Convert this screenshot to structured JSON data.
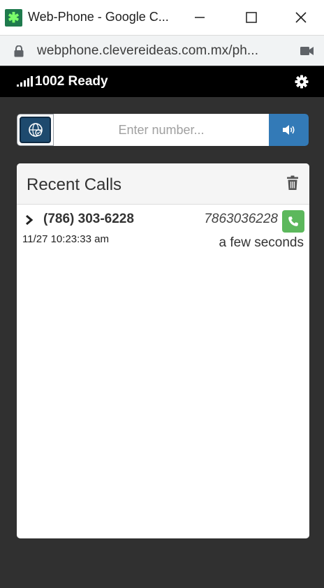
{
  "window": {
    "title": "Web-Phone - Google C...",
    "icon": "app-asterisk-icon"
  },
  "address_bar": {
    "url": "webphone.clevereideas.com.mx/ph..."
  },
  "status": {
    "text": "1002 Ready",
    "icon": "signal-icon"
  },
  "dialer": {
    "placeholder": "Enter number...",
    "value": ""
  },
  "recent_calls": {
    "title": "Recent Calls",
    "items": [
      {
        "name": "(786) 303-6228",
        "number": "7863036228",
        "datetime": "11/27 10:23:33 am",
        "ago": "a few seconds"
      }
    ]
  },
  "colors": {
    "status_bar": "#000000",
    "background": "#303030",
    "audio_button": "#337ab7",
    "call_button": "#5cb85c",
    "contact_button": "#1e4a6e"
  }
}
